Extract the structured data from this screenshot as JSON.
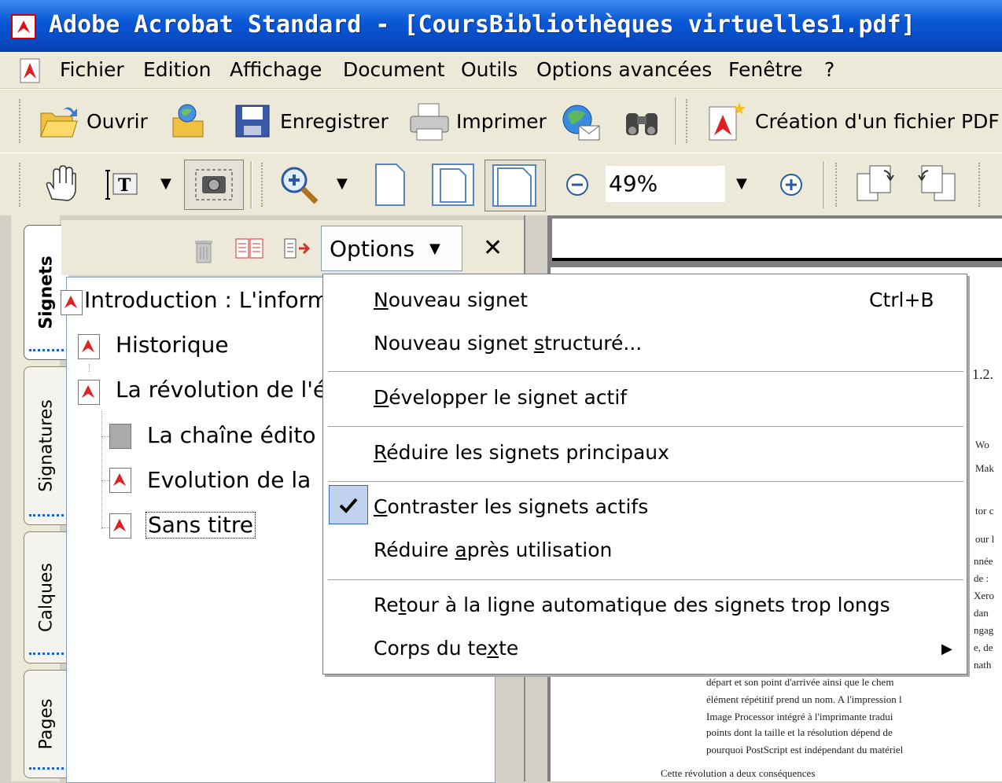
{
  "window": {
    "title": "Adobe Acrobat Standard - [CoursBibliothèques virtuelles1.pdf]"
  },
  "menubar": {
    "items": [
      "Fichier",
      "Edition",
      "Affichage",
      "Document",
      "Outils",
      "Options avancées",
      "Fenêtre",
      "?"
    ]
  },
  "toolbar1": {
    "open_label": "Ouvrir",
    "save_label": "Enregistrer",
    "print_label": "Imprimer",
    "create_pdf_label": "Création d'un fichier PDF"
  },
  "toolbar2": {
    "zoom_value": "49%"
  },
  "sidetabs": [
    "Signets",
    "Signatures",
    "Calques",
    "Pages"
  ],
  "bookmarks_panel": {
    "options_label": "Options",
    "tree": [
      "Introduction : L'inform",
      "Historique",
      "La révolution de l'é",
      "La chaîne édito",
      "Evolution de la",
      "Sans titre"
    ]
  },
  "options_menu": {
    "items": [
      {
        "pre": "",
        "u": "N",
        "post": "ouveau signet",
        "shortcut": "Ctrl+B"
      },
      {
        "pre": "Nouveau signet ",
        "u": "s",
        "post": "tructuré...",
        "shortcut": ""
      },
      {
        "pre": "",
        "u": "D",
        "post": "évelopper le signet actif",
        "shortcut": ""
      },
      {
        "pre": "",
        "u": "R",
        "post": "éduire les signets principaux",
        "shortcut": ""
      },
      {
        "pre": "",
        "u": "C",
        "post": "ontraster les signets actifs",
        "shortcut": "",
        "checked": true
      },
      {
        "pre": "Réduire ",
        "u": "a",
        "post": "près utilisation",
        "shortcut": ""
      },
      {
        "pre": "Re",
        "u": "t",
        "post": "our à la ligne automatique des signets trop longs",
        "shortcut": ""
      },
      {
        "pre": "Corps du te",
        "u": "x",
        "post": "te",
        "shortcut": "",
        "submenu": true
      }
    ]
  },
  "document_page": {
    "fragments": [
      "1.2.",
      "Wo",
      "Mak",
      "tor c",
      "our l",
      "nnée",
      "de :",
      "Xero",
      "dan",
      "ngag",
      "e, de",
      "nath",
      "départ et son point d'arrivée ainsi que le chem",
      "élément répétitif prend un nom. A l'impression l",
      "Image Processor intégré à l'imprimante tradui",
      "points dont la taille et la résolution dépend de",
      "pourquoi PostScript est indépendant du matériel",
      "Cette révolution a deux conséquences"
    ]
  }
}
